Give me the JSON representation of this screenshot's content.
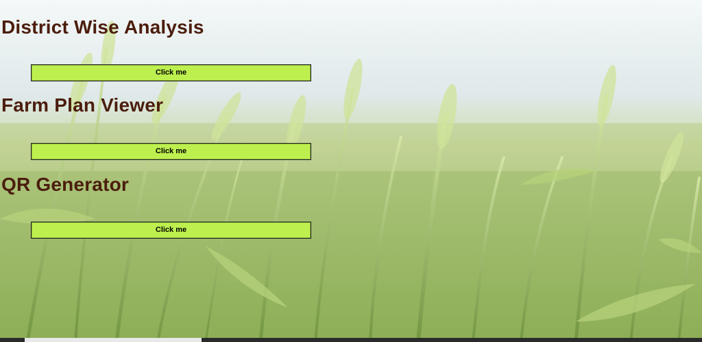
{
  "sections": [
    {
      "title": "District Wise Analysis",
      "button_label": "Click me"
    },
    {
      "title": "Farm Plan Viewer",
      "button_label": "Click me"
    },
    {
      "title": "QR Generator",
      "button_label": "Click me"
    }
  ],
  "colors": {
    "title_text": "#4b1d0d",
    "button_background": "#bdf04f",
    "button_border": "#222222"
  },
  "background": {
    "image": "wheat-field-background"
  }
}
